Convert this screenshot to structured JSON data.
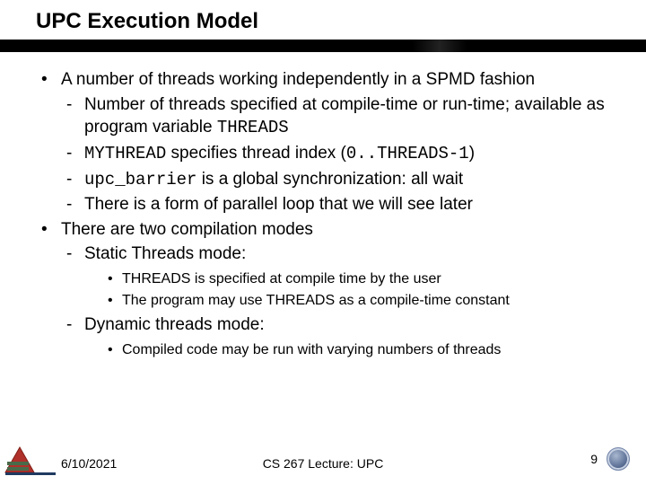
{
  "title": "UPC Execution Model",
  "bullets": [
    {
      "text": "A number of threads working independently in a SPMD fashion",
      "sub": [
        {
          "html": "Number of threads specified at compile-time or run-time; available as program variable <span class='mono'>THREADS</span>"
        },
        {
          "html": "<span class='mono'>MYTHREAD</span> specifies thread index (<span class='mono'>0..THREADS-1</span>)"
        },
        {
          "html": "<span class='mono'>upc_barrier</span> is a global synchronization: all wait"
        },
        {
          "html": "There is a form of parallel loop that we will see later"
        }
      ]
    },
    {
      "text": "There are two compilation modes",
      "sub": [
        {
          "html": "Static Threads mode:",
          "sub": [
            "THREADS is specified at compile time by the user",
            "The program may use THREADS as a compile-time constant"
          ]
        },
        {
          "html": "Dynamic threads mode:",
          "sub": [
            "Compiled code may be run with varying numbers of threads"
          ]
        }
      ]
    }
  ],
  "footer": {
    "date": "6/10/2021",
    "center": "CS 267 Lecture: UPC",
    "page": "9"
  }
}
